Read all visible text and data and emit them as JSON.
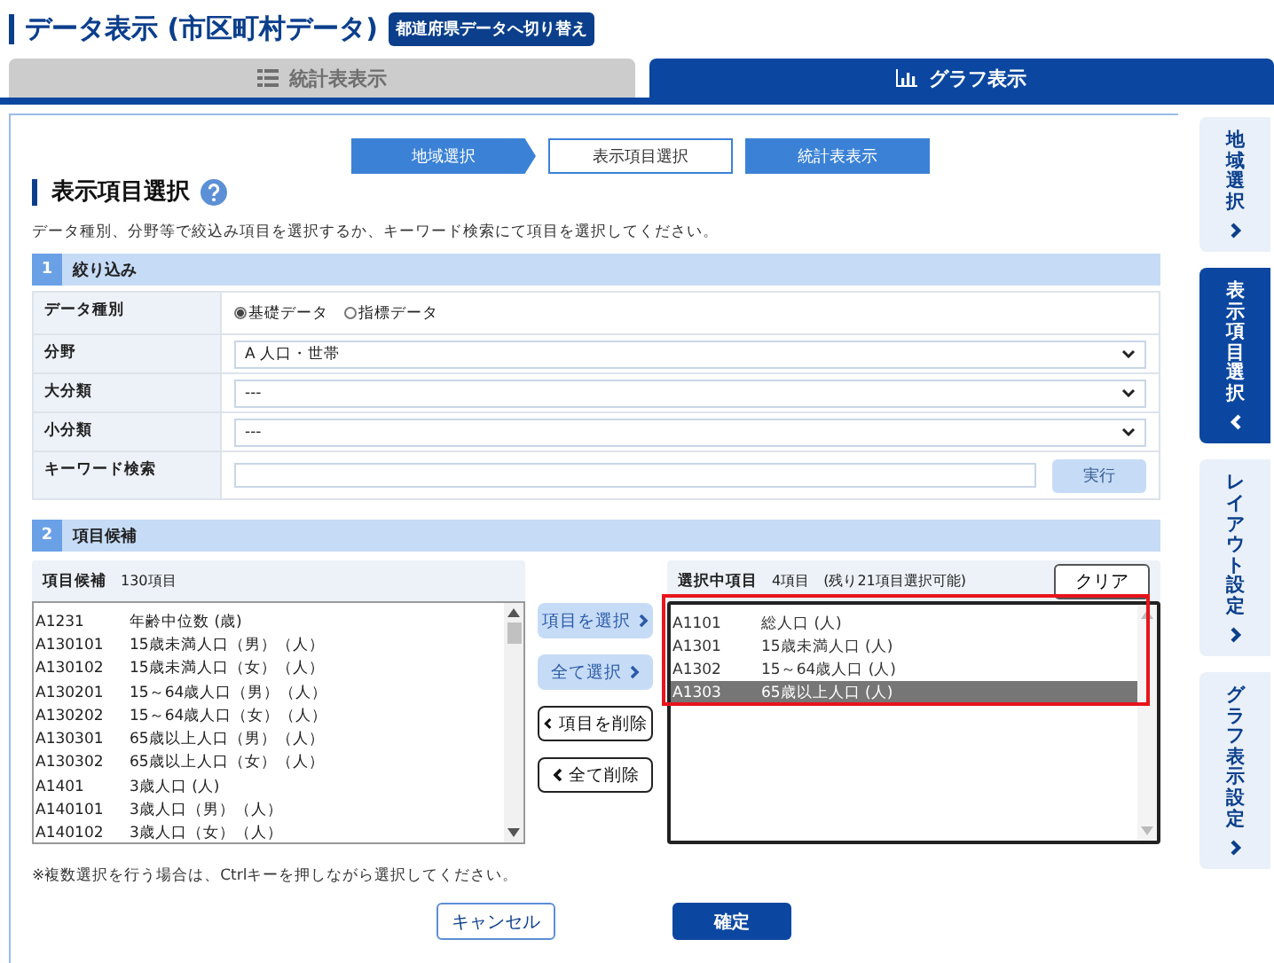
{
  "header": {
    "title": "データ表示 (市区町村データ)",
    "switch_button": "都道府県データへ切り替え"
  },
  "tabs": [
    {
      "label": "統計表表示",
      "selected": false,
      "kind": "table"
    },
    {
      "label": "グラフ表示",
      "selected": true,
      "kind": "chart"
    }
  ],
  "steps": [
    {
      "label": "地域選択",
      "selected": false
    },
    {
      "label": "表示項目選択",
      "selected": true
    },
    {
      "label": "統計表表示",
      "selected": false
    }
  ],
  "page_title": "表示項目選択",
  "description": "データ種別、分野等で絞込み項目を選択するか、キーワード検索にて項目を選択してください。",
  "filter": {
    "number": "1",
    "title": "絞り込み",
    "rows": [
      {
        "kind": "radio",
        "label": "データ種別",
        "options": [
          {
            "label": "基礎データ",
            "selected": true
          },
          {
            "label": "指標データ",
            "selected": false
          }
        ]
      },
      {
        "kind": "select",
        "label": "分野",
        "value": "A 人口・世帯"
      },
      {
        "kind": "select",
        "label": "大分類",
        "value": "---"
      },
      {
        "kind": "select",
        "label": "小分類",
        "value": "---"
      },
      {
        "kind": "search",
        "label": "キーワード検索",
        "button": "実行"
      }
    ]
  },
  "candidates": {
    "number": "2",
    "title": "項目候補",
    "list_title": "項目候補",
    "count": "130項目",
    "items": [
      {
        "code": "A1231",
        "name": "年齢中位数 (歳)"
      },
      {
        "code": "A130101",
        "name": "15歳未満人口（男）（人）"
      },
      {
        "code": "A130102",
        "name": "15歳未満人口（女）（人）"
      },
      {
        "code": "A130201",
        "name": "15～64歳人口（男）（人）"
      },
      {
        "code": "A130202",
        "name": "15～64歳人口（女）（人）"
      },
      {
        "code": "A130301",
        "name": "65歳以上人口（男）（人）"
      },
      {
        "code": "A130302",
        "name": "65歳以上人口（女）（人）"
      },
      {
        "code": "A1401",
        "name": "3歳人口 (人)"
      },
      {
        "code": "A140101",
        "name": "3歳人口（男）（人）"
      },
      {
        "code": "A140102",
        "name": "3歳人口（女）（人）"
      }
    ],
    "transfer_buttons": [
      {
        "label": "項目を選択",
        "kind": "add"
      },
      {
        "label": "全て選択",
        "kind": "add"
      },
      {
        "label": "項目を削除",
        "kind": "remove"
      },
      {
        "label": "全て削除",
        "kind": "remove"
      }
    ],
    "selected_title": "選択中項目",
    "selected_count": "4項目",
    "remaining": "(残り21項目選択可能)",
    "clear_button": "クリア",
    "selected_items": [
      {
        "code": "A1101",
        "name": "総人口 (人)",
        "selected": false
      },
      {
        "code": "A1301",
        "name": "15歳未満人口 (人)",
        "selected": false
      },
      {
        "code": "A1302",
        "name": "15～64歳人口 (人)",
        "selected": false
      },
      {
        "code": "A1303",
        "name": "65歳以上人口 (人)",
        "selected": true
      }
    ]
  },
  "note": "※複数選択を行う場合は、Ctrlキーを押しながら選択してください。",
  "buttons": {
    "cancel": "キャンセル",
    "confirm": "確定"
  },
  "side_tabs": [
    {
      "label": "地域選択",
      "selected": false
    },
    {
      "label": "表示項目選択",
      "selected": true
    },
    {
      "label": "レイアウト設定",
      "selected": false
    },
    {
      "label": "グラフ表示設定",
      "selected": false
    }
  ]
}
